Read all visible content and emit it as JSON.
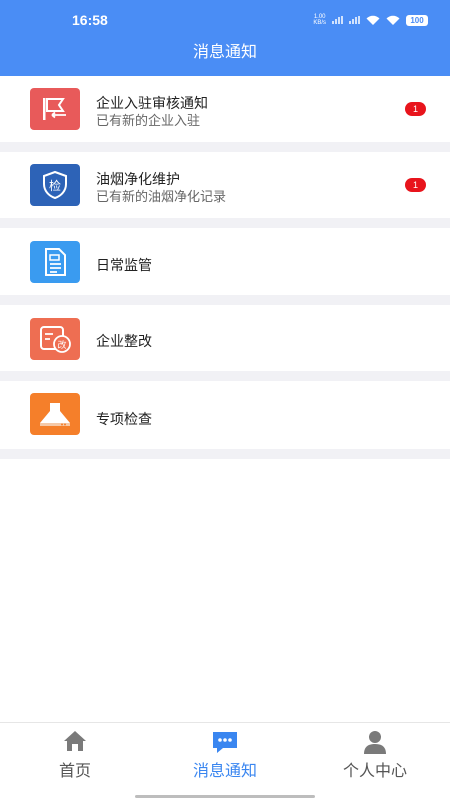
{
  "status_bar": {
    "time": "16:58",
    "net_speed": "1.00",
    "net_unit": "KB/s",
    "battery": "100"
  },
  "header": {
    "title": "消息通知"
  },
  "colors": {
    "header_bg": "#4a8df5",
    "badge": "#e8141c",
    "active_tab": "#3a86f0"
  },
  "items": [
    {
      "title": "企业入驻审核通知",
      "subtitle": "已有新的企业入驻",
      "badge": "1",
      "icon": "flag-icon",
      "icon_color": "#e85a5a"
    },
    {
      "title": "油烟净化维护",
      "subtitle": "已有新的油烟净化记录",
      "badge": "1",
      "icon": "inspection-shield-icon",
      "icon_color": "#2d63b7",
      "icon_text": "检"
    },
    {
      "title": "日常监管",
      "subtitle": "",
      "badge": "",
      "icon": "document-icon",
      "icon_color": "#3a9bf0"
    },
    {
      "title": "企业整改",
      "subtitle": "",
      "badge": "",
      "icon": "rectification-icon",
      "icon_color": "#ee6e52",
      "icon_text": "改"
    },
    {
      "title": "专项检查",
      "subtitle": "",
      "badge": "",
      "icon": "range-hood-icon",
      "icon_color": "#f57f2a"
    }
  ],
  "tabbar": {
    "tabs": [
      {
        "label": "首页",
        "icon": "home-icon",
        "active": false
      },
      {
        "label": "消息通知",
        "icon": "message-icon",
        "active": true
      },
      {
        "label": "个人中心",
        "icon": "person-icon",
        "active": false
      }
    ]
  }
}
